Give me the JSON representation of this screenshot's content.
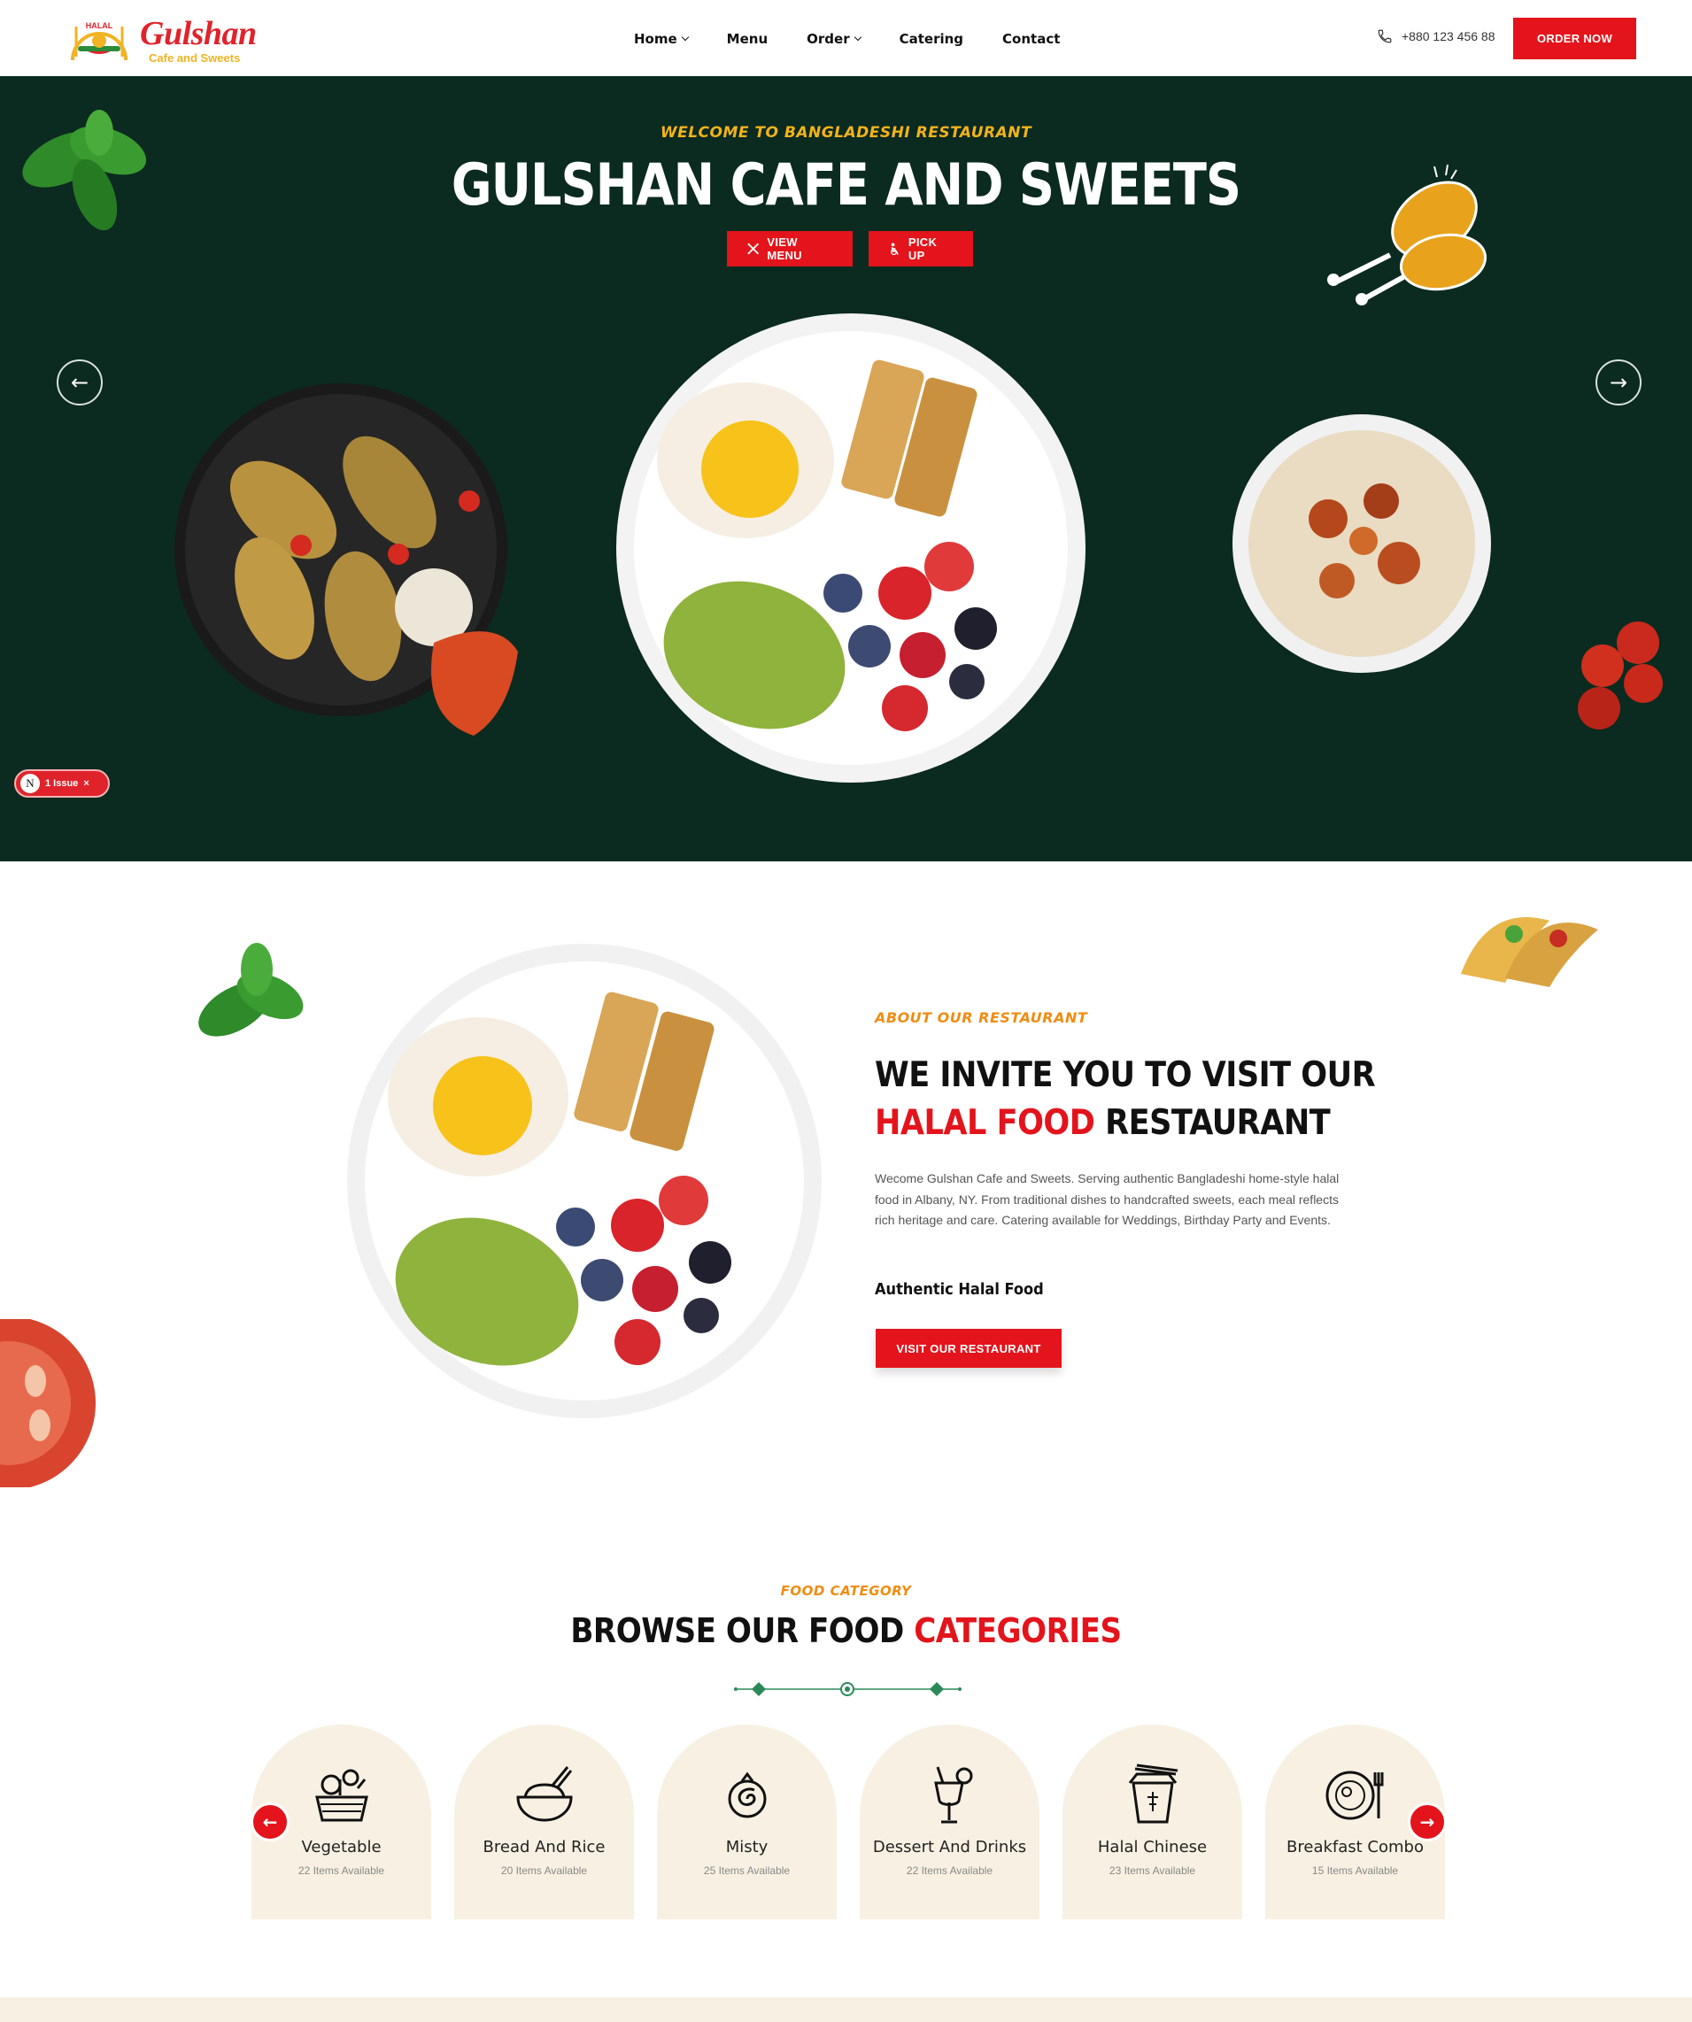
{
  "header": {
    "logo_badge": "HALAL",
    "logo_name": "Gulshan",
    "logo_sub": "Cafe and Sweets",
    "nav": [
      {
        "label": "Home",
        "dropdown": true
      },
      {
        "label": "Menu",
        "dropdown": false
      },
      {
        "label": "Order",
        "dropdown": true
      },
      {
        "label": "Catering",
        "dropdown": false
      },
      {
        "label": "Contact",
        "dropdown": false
      }
    ],
    "phone": "+880 123 456 88",
    "order_button": "ORDER NOW"
  },
  "hero": {
    "kicker": "WELCOME TO BANGLADESHI RESTAURANT",
    "title": "GULSHAN CAFE AND SWEETS",
    "view_menu": "VIEW MENU",
    "pick_up": "PICK UP",
    "prev_arrow": "←",
    "next_arrow": "→",
    "issue_badge": {
      "icon": "N",
      "label": "1 Issue",
      "close": "×"
    }
  },
  "about": {
    "kicker": "ABOUT OUR RESTAURANT",
    "title_line1": "WE INVITE YOU TO VISIT OUR",
    "title_red": "HALAL FOOD",
    "title_rest": " RESTAURANT",
    "text": "Wecome Gulshan Cafe and Sweets. Serving authentic Bangladeshi home-style halal food in Albany, NY. From traditional dishes to handcrafted sweets, each meal reflects rich heritage and care. Catering available for Weddings, Birthday Party and Events.",
    "feature": "Authentic Halal Food",
    "button": "VISIT OUR RESTAURANT"
  },
  "categories": {
    "kicker": "FOOD CATEGORY",
    "title_dark": "BROWSE OUR FOOD ",
    "title_red": "CATEGORIES",
    "prev": "←",
    "next": "→",
    "items": [
      {
        "name": "Vegetable",
        "count": "22 Items Available",
        "icon": "vegetable-basket-icon"
      },
      {
        "name": "Bread And Rice",
        "count": "20 Items Available",
        "icon": "rice-bowl-icon"
      },
      {
        "name": "Misty",
        "count": "25 Items Available",
        "icon": "sweet-icon"
      },
      {
        "name": "Dessert And Drinks",
        "count": "22 Items Available",
        "icon": "cocktail-icon"
      },
      {
        "name": "Halal Chinese",
        "count": "23 Items Available",
        "icon": "noodle-box-icon"
      },
      {
        "name": "Breakfast Combo",
        "count": "15 Items Available",
        "icon": "breakfast-plate-icon"
      }
    ]
  },
  "colors": {
    "brand_red": "#e3141b",
    "hero_bg": "#0b2a20",
    "accent_orange": "#f08c12",
    "accent_yellow": "#f2b31a",
    "card_bg": "#f8f1e3"
  }
}
